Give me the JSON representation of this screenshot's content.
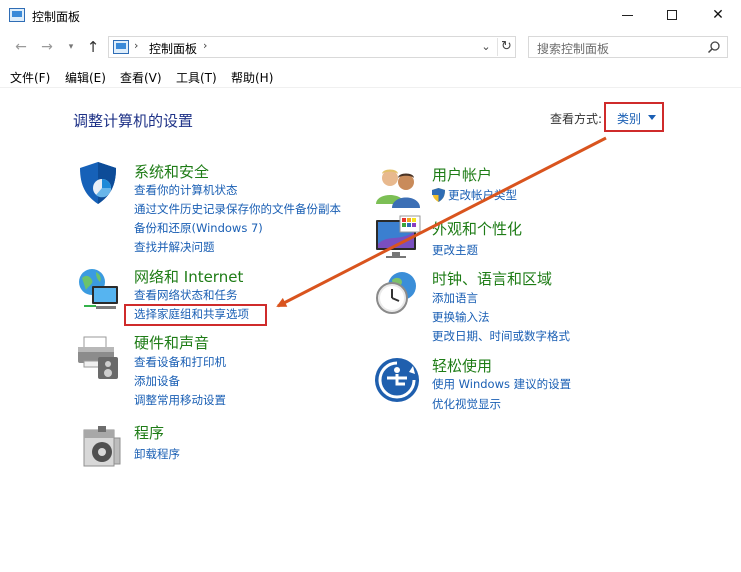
{
  "window": {
    "title": "控制面板"
  },
  "address": {
    "path": "控制面板",
    "search_placeholder": "搜索控制面板"
  },
  "menu": [
    "文件(F)",
    "编辑(E)",
    "查看(V)",
    "工具(T)",
    "帮助(H)"
  ],
  "main": {
    "heading": "调整计算机的设置",
    "view_by_label": "查看方式:",
    "view_by_value": "类别"
  },
  "categories": {
    "system_security": {
      "title": "系统和安全",
      "links": [
        "查看你的计算机状态",
        "通过文件历史记录保存你的文件备份副本",
        "备份和还原(Windows 7)",
        "查找并解决问题"
      ]
    },
    "network": {
      "title": "网络和 Internet",
      "links": [
        "查看网络状态和任务",
        "选择家庭组和共享选项"
      ]
    },
    "hardware": {
      "title": "硬件和声音",
      "links": [
        "查看设备和打印机",
        "添加设备",
        "调整常用移动设置"
      ]
    },
    "programs": {
      "title": "程序",
      "links": [
        "卸载程序"
      ]
    },
    "user_accounts": {
      "title": "用户帐户",
      "links": [
        "更改帐户类型"
      ]
    },
    "appearance": {
      "title": "外观和个性化",
      "links": [
        "更改主题"
      ]
    },
    "clock_region": {
      "title": "时钟、语言和区域",
      "links": [
        "添加语言",
        "更换输入法",
        "更改日期、时间或数字格式"
      ]
    },
    "ease_access": {
      "title": "轻松使用",
      "links": [
        "使用 Windows 建议的设置",
        "优化视觉显示"
      ]
    }
  },
  "colors": {
    "heading": "#1e3287",
    "category_title": "#1e7c16",
    "link": "#1a5fb4",
    "annotation_red": "#cf2b2b",
    "arrow": "#d9541e"
  }
}
